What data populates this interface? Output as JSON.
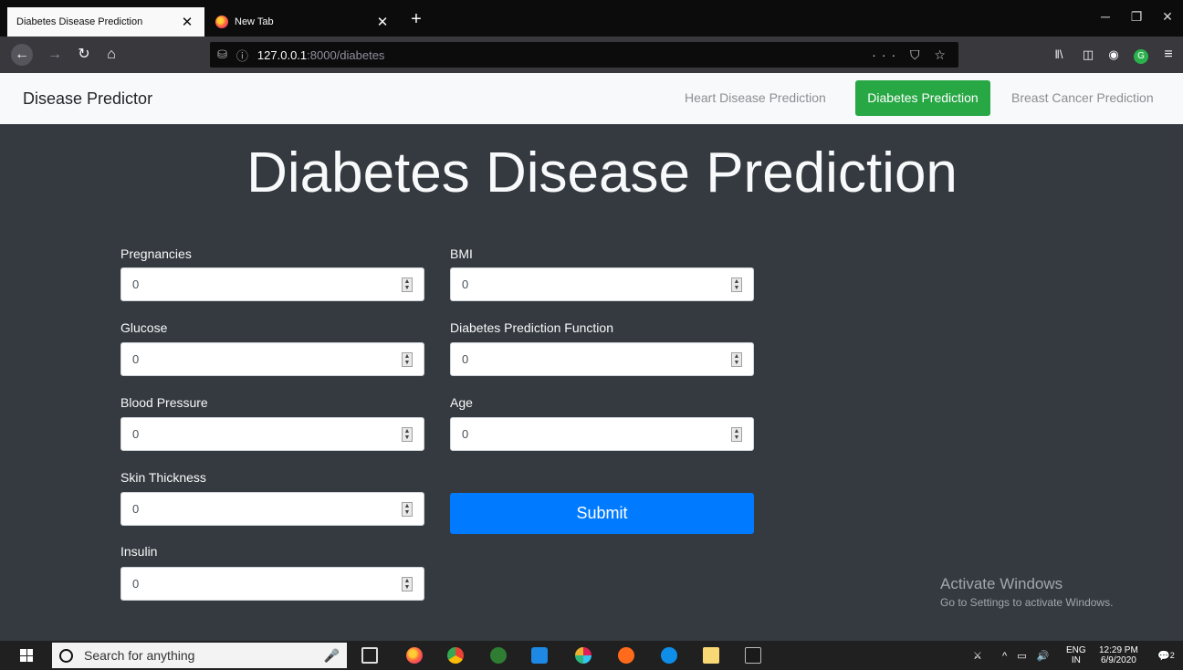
{
  "browser": {
    "active_tab": {
      "title": "Diabetes Disease Prediction",
      "close": "✕"
    },
    "inactive_tab": {
      "title": "New Tab",
      "close": "✕"
    },
    "new_tab": "+",
    "window_controls": [
      "─",
      "❐",
      "✕"
    ],
    "url_host": "127.0.0.1",
    "url_path": ":8000/diabetes",
    "url_right_icons": "··· ⛉ ☆",
    "toolbar_icons": [
      "library-icon",
      "sidebar-icon",
      "account-icon",
      "grammarly-icon",
      "menu-icon"
    ]
  },
  "navbar": {
    "brand": "Disease Predictor",
    "links": [
      "Heart Disease Prediction",
      "Diabetes Prediction",
      "Breast Cancer Prediction"
    ],
    "active_index": 1,
    "active_color": "#28a745"
  },
  "page": {
    "title": "Diabetes Disease Prediction",
    "left_fields": [
      {
        "label": "Pregnancies",
        "value": "0"
      },
      {
        "label": "Glucose",
        "value": "0"
      },
      {
        "label": "Blood Pressure",
        "value": "0"
      },
      {
        "label": "Skin Thickness",
        "value": "0"
      },
      {
        "label": "Insulin",
        "value": "0"
      }
    ],
    "right_fields": [
      {
        "label": "BMI",
        "value": "0"
      },
      {
        "label": "Diabetes Prediction Function",
        "value": "0"
      },
      {
        "label": "Age",
        "value": "0"
      }
    ],
    "submit_label": "Submit",
    "submit_color": "#007bff"
  },
  "watermark": {
    "line1": "Activate Windows",
    "line2": "Go to Settings to activate Windows."
  },
  "taskbar": {
    "search_placeholder": "Search for anything",
    "language": "ENG",
    "region": "IN",
    "time": "12:29 PM",
    "date": "6/9/2020",
    "notifications": "2",
    "chrome_badge": "1"
  }
}
